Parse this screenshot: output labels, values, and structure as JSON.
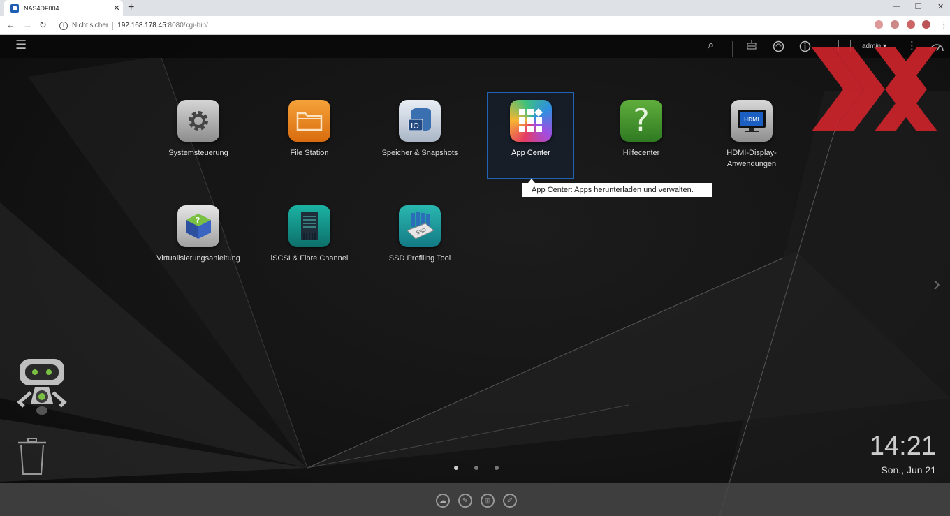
{
  "browser": {
    "tab_title": "NAS4DF004",
    "tab_close": "✕",
    "new_tab": "+",
    "minimize": "—",
    "restore": "❐",
    "close": "✕",
    "back": "←",
    "forward": "→",
    "reload": "↻",
    "info": "i",
    "security": "Nicht sicher",
    "url_host": "192.168.178.45",
    "url_path": ":8080/cgi-bin/",
    "menu": "⋮"
  },
  "topbar": {
    "menu_icon": "☰",
    "search_icon": "⌕",
    "user": "admin ▾",
    "more": "⋮"
  },
  "apps": [
    {
      "label": "Systemsteuerung"
    },
    {
      "label": "File Station"
    },
    {
      "label": "Speicher & Snapshots"
    },
    {
      "label": "App Center"
    },
    {
      "label": "Hilfecenter"
    },
    {
      "label": "HDMI-Display-Anwendungen"
    },
    {
      "label": "Virtualisierungsanleitung"
    },
    {
      "label": "iSCSI & Fibre Channel"
    },
    {
      "label": "SSD Profiling Tool"
    }
  ],
  "tooltip": "App Center: Apps herunterladen und verwalten.",
  "clock": {
    "time": "14:21",
    "date": "Son., Jun 21"
  },
  "pager": {
    "active_page": 1,
    "pages": 3
  },
  "next_arrow": "›",
  "colors": {
    "accent": "#1f64b4",
    "watermark": "#d0242b"
  }
}
